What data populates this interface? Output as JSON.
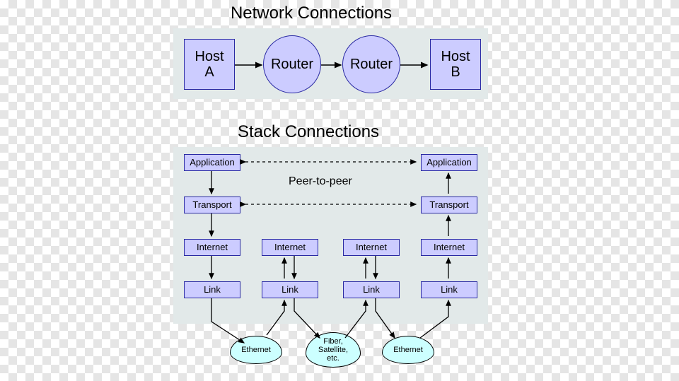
{
  "titles": {
    "network": "Network Connections",
    "stack": "Stack Connections",
    "peer": "Peer-to-peer"
  },
  "network": {
    "hostA": "Host\nA",
    "router1": "Router",
    "router2": "Router",
    "hostB": "Host\nB"
  },
  "stack": {
    "app": "Application",
    "transport": "Transport",
    "internet": "Internet",
    "link": "Link"
  },
  "clouds": {
    "eth1": "Ethernet",
    "fiber": "Fiber,\nSatellite,\netc.",
    "eth2": "Ethernet"
  }
}
